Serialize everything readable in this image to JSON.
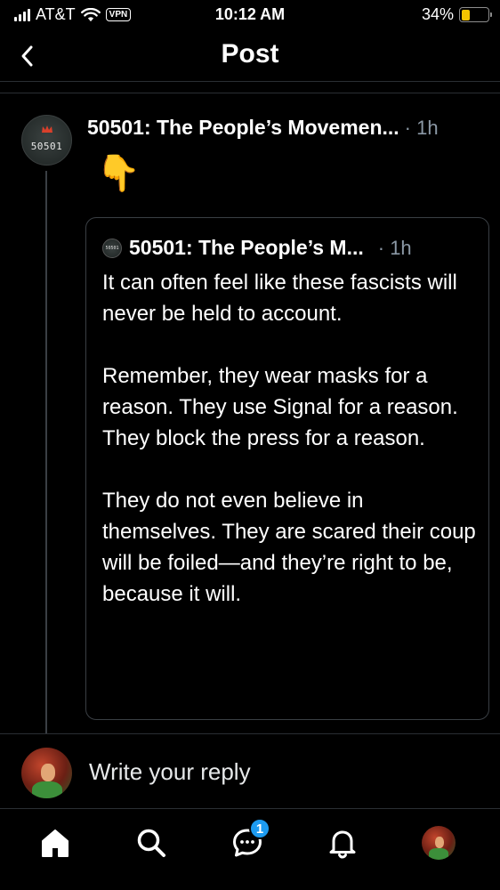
{
  "status_bar": {
    "carrier": "AT&T",
    "vpn": "VPN",
    "time": "10:12 AM",
    "battery": "34%",
    "battery_level": 0.34,
    "battery_color": "#f5c400"
  },
  "header": {
    "title": "Post",
    "back_icon": "chevron-left-icon"
  },
  "post": {
    "author": "50501: The People’s Movemen...",
    "time": "· 1h",
    "avatar_text": "50501",
    "emoji": "👇"
  },
  "quote": {
    "author": "50501: The People’s M...",
    "time": "· 1h",
    "avatar_text": "50501",
    "paragraphs": [
      "It can often feel like these fascists will never be held to account.",
      "Remember, they wear masks for a reason. They use Signal for a reason. They block the press for a reason.",
      "They do not even believe in themselves. They are scared their coup will be foiled—and they’re right to be, because it will."
    ]
  },
  "reply": {
    "placeholder": "Write your reply"
  },
  "tab_bar": {
    "tabs": [
      "home-icon",
      "search-icon",
      "chat-icon",
      "bell-icon",
      "profile-avatar"
    ],
    "chat_badge": "1",
    "accent": "#1d9bf0"
  }
}
